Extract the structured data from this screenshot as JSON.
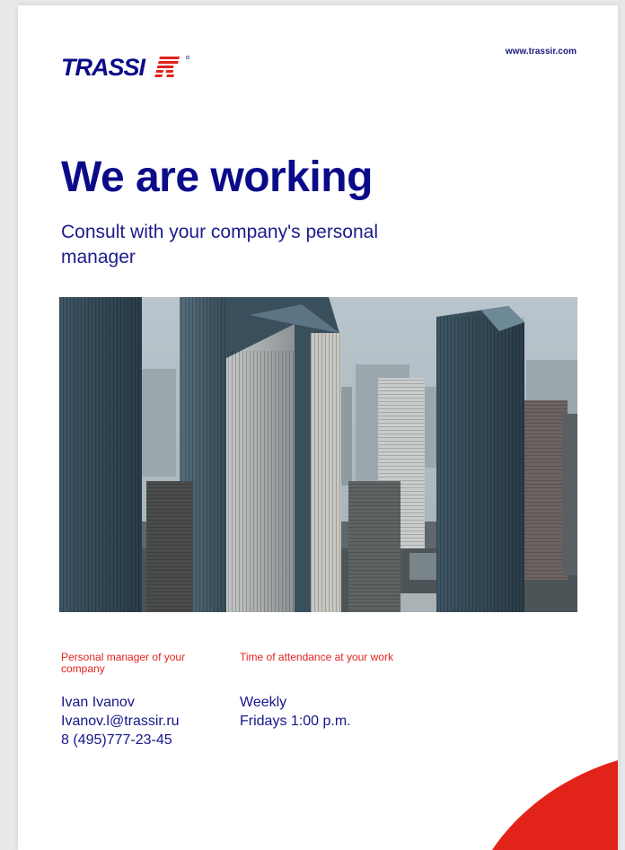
{
  "header": {
    "logo_text": "TRASSIR",
    "website": "www.trassir.com"
  },
  "hero": {
    "headline": "We are working",
    "subtitle": "Consult with your company's personal manager"
  },
  "photo": {
    "icon": "city-skyline-photo"
  },
  "info": {
    "manager": {
      "label": "Personal manager of your company",
      "name": "Ivan Ivanov",
      "email": "Ivanov.l@trassir.ru",
      "phone": "8 (495)777-23-45"
    },
    "attendance": {
      "label": "Time of attendance at your work",
      "frequency": "Weekly",
      "time": "Fridays 1:00 p.m."
    }
  },
  "colors": {
    "brand_blue": "#0b0b8a",
    "accent_red": "#e2231a"
  }
}
